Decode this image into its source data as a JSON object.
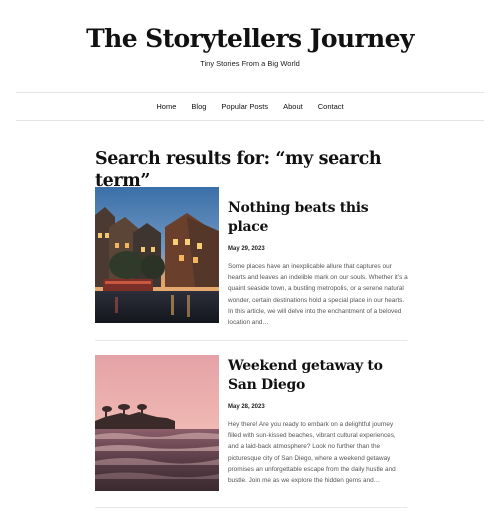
{
  "site": {
    "title": "The Storytellers Journey",
    "tagline": "Tiny Stories From a Big World"
  },
  "nav": {
    "items": [
      "Home",
      "Blog",
      "Popular Posts",
      "About",
      "Contact"
    ]
  },
  "search": {
    "heading": "Search results for: “my search term”"
  },
  "posts": [
    {
      "title": "Nothing beats this place",
      "date": "May 29, 2023",
      "excerpt": "Some places have an inexplicable allure that captures our hearts and leaves an indelible mark on our souls. Whether it’s a quaint seaside town, a bustling metropolis, or a serene natural wonder, certain destinations hold a special place in our hearts. In this article, we will delve into the enchantment of a beloved location and…",
      "image": "riverside-town-at-dusk"
    },
    {
      "title": "Weekend getaway to San Diego",
      "date": "May 28, 2023",
      "excerpt": "Hey there! Are you ready to embark on a delightful journey filled with sun-kissed beaches, vibrant cultural experiences, and a laid-back atmosphere? Look no further than the picturesque city of San Diego, where a weekend getaway promises an unforgettable escape from the daily hustle and bustle. Join me as we explore the hidden gems and…",
      "image": "coastal-sunset-waves"
    }
  ]
}
